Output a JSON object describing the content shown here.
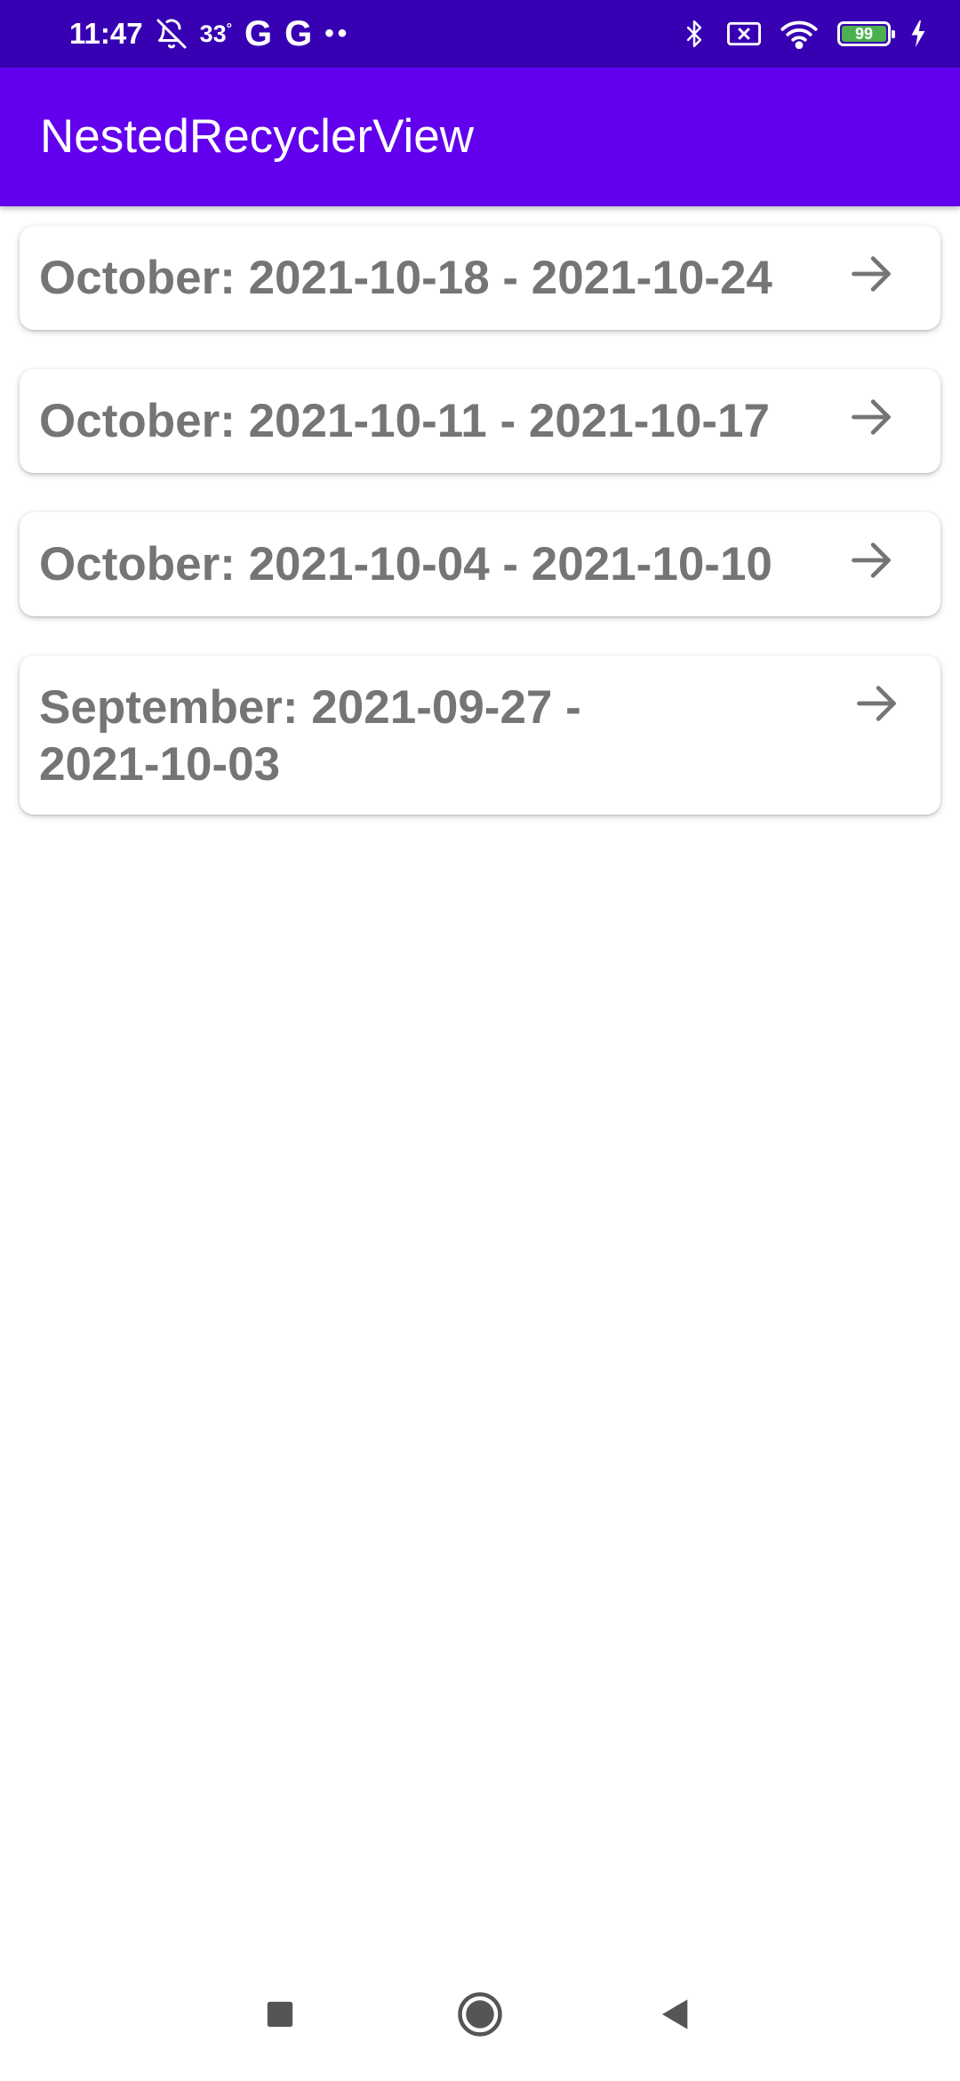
{
  "status_bar": {
    "time": "11:47",
    "temperature": "33",
    "temperature_unit": "°",
    "g1": "G",
    "g2": "G",
    "dots": "••",
    "battery_level": "99",
    "battery_color": "#4caf50",
    "background": "#3700b3"
  },
  "app_bar": {
    "title": "NestedRecyclerView",
    "background": "#6200ee"
  },
  "list": {
    "items": [
      {
        "label": "October: 2021-10-18 - 2021-10-24",
        "icon": "arrow-right-icon"
      },
      {
        "label": "October: 2021-10-11 - 2021-10-17",
        "icon": "arrow-right-icon"
      },
      {
        "label": "October: 2021-10-04 - 2021-10-10",
        "icon": "arrow-right-icon"
      },
      {
        "label": "September: 2021-09-27 - 2021-10-03",
        "icon": "arrow-right-icon"
      }
    ]
  },
  "nav_bar": {
    "buttons": [
      "recents-icon",
      "home-icon",
      "back-icon"
    ]
  }
}
